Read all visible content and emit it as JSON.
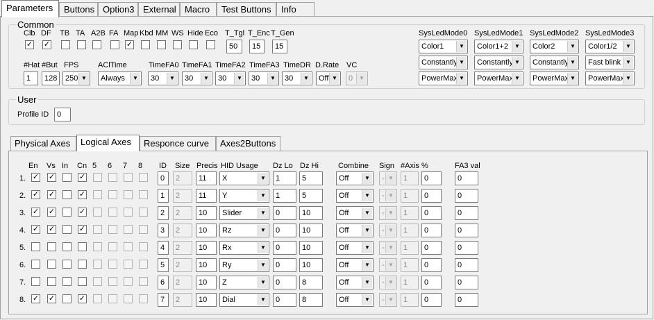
{
  "tabs": [
    "Parameters",
    "Buttons",
    "Option3",
    "External",
    "Macro",
    "Test Buttons",
    "Info"
  ],
  "common": {
    "legend": "Common",
    "flags": [
      {
        "label": "Clb",
        "checked": true
      },
      {
        "label": "DF",
        "checked": true
      },
      {
        "label": "TB",
        "checked": false
      },
      {
        "label": "TA",
        "checked": false
      },
      {
        "label": "A2B",
        "checked": false
      },
      {
        "label": "FA",
        "checked": false
      },
      {
        "label": "Map",
        "checked": true
      },
      {
        "label": "Kbd",
        "checked": false
      },
      {
        "label": "MM",
        "checked": false
      },
      {
        "label": "WS",
        "checked": false
      },
      {
        "label": "Hide",
        "checked": false
      },
      {
        "label": "Eco",
        "checked": false
      }
    ],
    "t_tgl": {
      "label": "T_Tgl",
      "value": "50"
    },
    "t_enc": {
      "label": "T_Enc",
      "value": "15"
    },
    "t_gen": {
      "label": "T_Gen",
      "value": "15"
    },
    "hat": {
      "label": "#Hat",
      "value": "1"
    },
    "but": {
      "label": "#But",
      "value": "128"
    },
    "fps": {
      "label": "FPS",
      "value": "250"
    },
    "acl_time": {
      "label": "AClTime",
      "value": "Always"
    },
    "time_fa0": {
      "label": "TimeFA0",
      "value": "30"
    },
    "time_fa1": {
      "label": "TimeFA1",
      "value": "30"
    },
    "time_fa2": {
      "label": "TimeFA2",
      "value": "30"
    },
    "time_fa3": {
      "label": "TimeFA3",
      "value": "30"
    },
    "time_dr": {
      "label": "TimeDR",
      "value": "30"
    },
    "d_rate": {
      "label": "D.Rate",
      "value": "Off"
    },
    "vc": {
      "label": "VC",
      "value": "0"
    },
    "sys_leds": [
      {
        "label": "SysLedMode0",
        "color": "Color1",
        "mode": "Constantly",
        "power": "PowerMax"
      },
      {
        "label": "SysLedMode1",
        "color": "Color1+2",
        "mode": "Constantly",
        "power": "PowerMax"
      },
      {
        "label": "SysLedMode2",
        "color": "Color2",
        "mode": "Constantly",
        "power": "PowerMax"
      },
      {
        "label": "SysLedMode3",
        "color": "Color1/2",
        "mode": "Fast blink",
        "power": "PowerMax"
      }
    ]
  },
  "user": {
    "legend": "User",
    "profile_label": "Profile ID",
    "profile_value": "0"
  },
  "subtabs": [
    "Physical Axes",
    "Logical Axes",
    "Responce curve",
    "Axes2Buttons"
  ],
  "axes": {
    "headers": {
      "en": "En",
      "vs": "Vs",
      "in": "In",
      "cn": "Cn",
      "c5": "5",
      "c6": "6",
      "c7": "7",
      "c8": "8",
      "id": "ID",
      "size": "Size",
      "precis": "Precis",
      "hid": "HID Usage",
      "dzlo": "Dz Lo",
      "dzhi": "Dz Hi",
      "combine": "Combine",
      "sign": "Sign",
      "naxis": "#Axis",
      "pct": "%",
      "fa3": "FA3 val"
    },
    "rows": [
      {
        "num": "1.",
        "checks": [
          true,
          true,
          false,
          true,
          false,
          false,
          false,
          false
        ],
        "id": "0",
        "size": "2",
        "precis": "11",
        "hid": "X",
        "dzlo": "1",
        "dzhi": "5",
        "combine": "Off",
        "sign": "-",
        "naxis": "1",
        "pct": "0",
        "fa3": "0"
      },
      {
        "num": "2.",
        "checks": [
          true,
          true,
          false,
          true,
          false,
          false,
          false,
          false
        ],
        "id": "1",
        "size": "2",
        "precis": "11",
        "hid": "Y",
        "dzlo": "1",
        "dzhi": "5",
        "combine": "Off",
        "sign": "-",
        "naxis": "1",
        "pct": "0",
        "fa3": "0"
      },
      {
        "num": "3.",
        "checks": [
          true,
          true,
          false,
          true,
          false,
          false,
          false,
          false
        ],
        "id": "2",
        "size": "2",
        "precis": "10",
        "hid": "Slider",
        "dzlo": "0",
        "dzhi": "10",
        "combine": "Off",
        "sign": "-",
        "naxis": "1",
        "pct": "0",
        "fa3": "0"
      },
      {
        "num": "4.",
        "checks": [
          true,
          true,
          false,
          true,
          false,
          false,
          false,
          false
        ],
        "id": "3",
        "size": "2",
        "precis": "10",
        "hid": "Rz",
        "dzlo": "0",
        "dzhi": "10",
        "combine": "Off",
        "sign": "-",
        "naxis": "1",
        "pct": "0",
        "fa3": "0"
      },
      {
        "num": "5.",
        "checks": [
          false,
          false,
          false,
          false,
          false,
          false,
          false,
          false
        ],
        "id": "4",
        "size": "2",
        "precis": "10",
        "hid": "Rx",
        "dzlo": "0",
        "dzhi": "10",
        "combine": "Off",
        "sign": "-",
        "naxis": "1",
        "pct": "0",
        "fa3": "0"
      },
      {
        "num": "6.",
        "checks": [
          false,
          false,
          false,
          false,
          false,
          false,
          false,
          false
        ],
        "id": "5",
        "size": "2",
        "precis": "10",
        "hid": "Ry",
        "dzlo": "0",
        "dzhi": "10",
        "combine": "Off",
        "sign": "-",
        "naxis": "1",
        "pct": "0",
        "fa3": "0"
      },
      {
        "num": "7.",
        "checks": [
          false,
          false,
          false,
          false,
          false,
          false,
          false,
          false
        ],
        "id": "6",
        "size": "2",
        "precis": "10",
        "hid": "Z",
        "dzlo": "0",
        "dzhi": "8",
        "combine": "Off",
        "sign": "-",
        "naxis": "1",
        "pct": "0",
        "fa3": "0"
      },
      {
        "num": "8.",
        "checks": [
          true,
          true,
          false,
          true,
          false,
          false,
          false,
          false
        ],
        "id": "7",
        "size": "2",
        "precis": "10",
        "hid": "Dial",
        "dzlo": "0",
        "dzhi": "8",
        "combine": "Off",
        "sign": "-",
        "naxis": "1",
        "pct": "0",
        "fa3": "0"
      }
    ]
  }
}
